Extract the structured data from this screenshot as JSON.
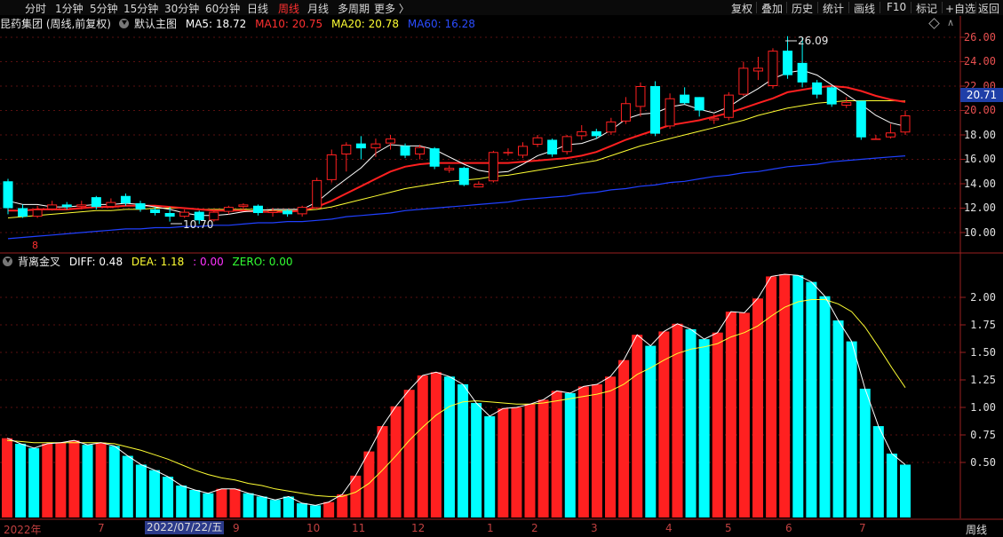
{
  "toolbar": {
    "periods": [
      "分时",
      "1分钟",
      "5分钟",
      "15分钟",
      "30分钟",
      "60分钟",
      "日线",
      "周线",
      "月线",
      "多周期",
      "更多 〉"
    ],
    "active_period": "周线",
    "right_buttons": [
      "复权",
      "叠加",
      "历史",
      "统计",
      "画线",
      "F10",
      "标记",
      "+自选",
      "返回"
    ]
  },
  "main_header": {
    "title": "昆药集团 (周线,前复权)",
    "indicator": "默认主图",
    "ma5": "MA5: 18.72",
    "ma10": "MA10: 20.75",
    "ma20": "MA20: 20.78",
    "ma60": "MA60: 16.28"
  },
  "macd_header": {
    "indicator": "背离金叉",
    "diff": "DIFF: 0.48",
    "dea": "DEA: 1.18",
    "extra": ": 0.00",
    "zero": "ZERO: 0.00"
  },
  "price_axis": [
    "26.00",
    "24.00",
    "22.00",
    "20.00",
    "18.00",
    "16.00",
    "14.00",
    "12.00",
    "10.00"
  ],
  "macd_axis": [
    "2.00",
    "1.75",
    "1.50",
    "1.25",
    "1.00",
    "0.75",
    "0.50"
  ],
  "current_price": "20.71",
  "high_label": "26.09",
  "low_label": "10.70",
  "time_axis": [
    "2022年",
    "7",
    "9",
    "10",
    "11",
    "12",
    "1",
    "2",
    "3",
    "4",
    "5",
    "6",
    "7"
  ],
  "cursor_date": "2022/07/22/五",
  "footer_period": "周线",
  "colors": {
    "up": "#ff2020",
    "down": "#00ffff",
    "ma5": "#ffffff",
    "ma10": "#ff2020",
    "ma20": "#ffff33",
    "ma60": "#2040ff",
    "active": "#ff3030"
  },
  "chart_data": [
    {
      "type": "candlestick",
      "title": "昆药集团 (周线,前复权)",
      "ylim": [
        9,
        27
      ],
      "candles": [
        [
          14.2,
          12.0,
          14.4,
          11.5
        ],
        [
          12.0,
          11.3,
          12.3,
          11.2
        ],
        [
          11.3,
          11.9,
          12.2,
          11.2
        ],
        [
          11.9,
          12.3,
          12.6,
          11.8
        ],
        [
          12.3,
          12.1,
          12.5,
          11.9
        ],
        [
          12.1,
          12.3,
          12.6,
          11.9
        ],
        [
          12.9,
          12.1,
          13.0,
          11.9
        ],
        [
          12.1,
          12.5,
          12.8,
          12.0
        ],
        [
          13.0,
          12.4,
          13.2,
          12.2
        ],
        [
          12.4,
          11.9,
          12.6,
          11.7
        ],
        [
          11.9,
          11.6,
          12.1,
          11.4
        ],
        [
          11.6,
          11.3,
          12.1,
          10.9
        ],
        [
          11.3,
          11.7,
          11.9,
          11.2
        ],
        [
          11.7,
          11.0,
          11.8,
          10.7
        ],
        [
          11.0,
          11.7,
          11.9,
          10.9
        ],
        [
          11.7,
          12.1,
          12.2,
          11.5
        ],
        [
          12.1,
          12.3,
          12.4,
          11.8
        ],
        [
          12.2,
          11.6,
          12.3,
          11.4
        ],
        [
          11.6,
          11.8,
          12.0,
          11.3
        ],
        [
          11.8,
          11.5,
          11.9,
          11.3
        ],
        [
          11.5,
          12.1,
          12.2,
          11.3
        ],
        [
          12.0,
          14.3,
          14.5,
          11.9
        ],
        [
          14.3,
          16.4,
          16.8,
          14.1
        ],
        [
          16.4,
          17.2,
          17.4,
          15.0
        ],
        [
          17.3,
          16.9,
          17.9,
          16.0
        ],
        [
          16.9,
          17.3,
          17.7,
          16.2
        ],
        [
          17.3,
          17.7,
          18.0,
          16.8
        ],
        [
          17.1,
          16.3,
          17.3,
          16.1
        ],
        [
          16.4,
          17.0,
          17.2,
          16.0
        ],
        [
          16.9,
          15.4,
          17.0,
          15.2
        ],
        [
          15.1,
          15.3,
          15.5,
          14.9
        ],
        [
          15.3,
          13.9,
          15.4,
          13.8
        ],
        [
          13.7,
          14.0,
          14.2,
          13.7
        ],
        [
          14.2,
          16.6,
          16.7,
          14.1
        ],
        [
          16.5,
          16.6,
          16.9,
          16.3
        ],
        [
          16.3,
          17.1,
          17.4,
          16.1
        ],
        [
          17.2,
          17.8,
          18.0,
          17.0
        ],
        [
          17.6,
          16.4,
          17.7,
          16.2
        ],
        [
          16.6,
          17.9,
          18.0,
          16.4
        ],
        [
          17.9,
          18.3,
          18.8,
          17.6
        ],
        [
          18.3,
          17.9,
          18.5,
          17.7
        ],
        [
          18.2,
          19.1,
          19.4,
          18.0
        ],
        [
          19.1,
          20.6,
          21.1,
          18.9
        ],
        [
          20.3,
          22.0,
          22.3,
          19.5
        ],
        [
          22.0,
          18.1,
          22.4,
          17.9
        ],
        [
          18.7,
          21.0,
          21.4,
          18.5
        ],
        [
          21.3,
          20.6,
          21.9,
          20.5
        ],
        [
          21.1,
          20.0,
          21.1,
          19.5
        ],
        [
          19.2,
          19.4,
          19.7,
          18.9
        ],
        [
          19.4,
          21.3,
          21.5,
          19.2
        ],
        [
          21.3,
          23.5,
          24.0,
          21.2
        ],
        [
          23.2,
          23.5,
          24.4,
          22.5
        ],
        [
          22.0,
          24.9,
          25.1,
          21.8
        ],
        [
          24.9,
          22.9,
          26.09,
          22.6
        ],
        [
          23.9,
          22.3,
          26.0,
          21.9
        ],
        [
          22.3,
          21.3,
          22.5,
          21.0
        ],
        [
          21.9,
          20.5,
          22.0,
          20.3
        ],
        [
          20.4,
          20.7,
          21.1,
          20.2
        ],
        [
          20.8,
          17.8,
          20.8,
          17.6
        ],
        [
          17.7,
          17.7,
          18.0,
          17.6
        ],
        [
          17.8,
          18.2,
          18.9,
          17.7
        ],
        [
          18.2,
          19.6,
          20.0,
          18.0
        ]
      ],
      "ma5": [
        12.6,
        12.3,
        12.3,
        12.1,
        12.1,
        12.2,
        12.3,
        12.3,
        12.4,
        12.3,
        12.1,
        11.9,
        11.6,
        11.4,
        11.4,
        11.5,
        11.7,
        11.8,
        11.9,
        11.9,
        11.9,
        12.5,
        13.5,
        14.4,
        15.3,
        16.5,
        17.2,
        17.1,
        17.1,
        16.8,
        16.2,
        15.6,
        15.1,
        14.9,
        15.0,
        15.6,
        16.3,
        16.7,
        17.2,
        17.3,
        17.7,
        18.4,
        19.3,
        19.7,
        19.8,
        20.3,
        20.5,
        20.1,
        19.8,
        20.3,
        21.1,
        21.8,
        22.6,
        23.1,
        23.3,
        22.9,
        22.1,
        21.3,
        20.5,
        19.6,
        19.0,
        18.7
      ],
      "ma10": [
        11.8,
        11.8,
        11.9,
        11.9,
        11.9,
        12.0,
        12.1,
        12.1,
        12.2,
        12.2,
        12.2,
        12.1,
        12.0,
        11.9,
        11.8,
        11.8,
        11.8,
        11.7,
        11.7,
        11.7,
        11.8,
        12.1,
        12.6,
        13.2,
        13.8,
        14.4,
        15.0,
        15.4,
        15.6,
        15.7,
        15.7,
        15.7,
        15.7,
        15.7,
        15.7,
        15.8,
        15.9,
        16.0,
        16.1,
        16.3,
        16.6,
        17.1,
        17.6,
        18.0,
        18.4,
        18.8,
        19.0,
        19.2,
        19.5,
        19.8,
        20.2,
        20.6,
        21.0,
        21.5,
        21.7,
        21.9,
        22.0,
        21.9,
        21.6,
        21.2,
        20.9,
        20.7
      ],
      "ma20": [
        11.2,
        11.3,
        11.4,
        11.5,
        11.6,
        11.7,
        11.8,
        11.8,
        11.9,
        11.9,
        12.0,
        12.0,
        12.0,
        11.9,
        11.9,
        11.9,
        11.9,
        11.9,
        11.8,
        11.8,
        11.8,
        11.9,
        12.1,
        12.4,
        12.7,
        13.0,
        13.3,
        13.6,
        13.8,
        14.0,
        14.2,
        14.3,
        14.4,
        14.6,
        14.7,
        14.9,
        15.1,
        15.3,
        15.5,
        15.7,
        15.9,
        16.3,
        16.7,
        17.1,
        17.4,
        17.7,
        18.0,
        18.3,
        18.6,
        18.9,
        19.2,
        19.6,
        19.9,
        20.2,
        20.4,
        20.6,
        20.7,
        20.8,
        20.8,
        20.8,
        20.8,
        20.78
      ],
      "ma60": [
        9.5,
        9.6,
        9.7,
        9.8,
        9.9,
        10.0,
        10.1,
        10.2,
        10.3,
        10.3,
        10.4,
        10.4,
        10.5,
        10.5,
        10.6,
        10.6,
        10.7,
        10.8,
        10.8,
        10.9,
        10.9,
        11.0,
        11.1,
        11.3,
        11.4,
        11.5,
        11.6,
        11.8,
        11.9,
        12.0,
        12.1,
        12.2,
        12.3,
        12.4,
        12.5,
        12.7,
        12.8,
        12.9,
        13.0,
        13.2,
        13.3,
        13.5,
        13.6,
        13.8,
        13.9,
        14.1,
        14.2,
        14.4,
        14.6,
        14.7,
        14.9,
        15.0,
        15.2,
        15.4,
        15.5,
        15.6,
        15.8,
        15.9,
        16.0,
        16.1,
        16.2,
        16.28
      ]
    },
    {
      "type": "bar",
      "title": "背离金叉",
      "ylim": [
        0.0,
        2.3
      ],
      "values": [
        0.72,
        0.67,
        0.63,
        0.67,
        0.68,
        0.7,
        0.66,
        0.68,
        0.65,
        0.56,
        0.48,
        0.43,
        0.37,
        0.29,
        0.25,
        0.22,
        0.26,
        0.26,
        0.22,
        0.19,
        0.16,
        0.19,
        0.13,
        0.11,
        0.14,
        0.21,
        0.38,
        0.6,
        0.83,
        1.01,
        1.16,
        1.29,
        1.32,
        1.28,
        1.21,
        1.04,
        0.92,
        0.99,
        1.0,
        1.03,
        1.07,
        1.15,
        1.13,
        1.19,
        1.21,
        1.28,
        1.43,
        1.66,
        1.56,
        1.69,
        1.76,
        1.71,
        1.62,
        1.68,
        1.87,
        1.86,
        1.99,
        2.19,
        2.21,
        2.2,
        2.14,
        2.01,
        1.79,
        1.6,
        1.17,
        0.83,
        0.58,
        0.48
      ],
      "colors": [
        "u",
        "d",
        "d",
        "u",
        "u",
        "u",
        "d",
        "u",
        "d",
        "d",
        "d",
        "d",
        "d",
        "d",
        "d",
        "d",
        "u",
        "u",
        "d",
        "d",
        "d",
        "d",
        "d",
        "d",
        "u",
        "u",
        "u",
        "u",
        "u",
        "u",
        "u",
        "u",
        "u",
        "d",
        "d",
        "d",
        "d",
        "u",
        "u",
        "u",
        "u",
        "u",
        "d",
        "u",
        "u",
        "u",
        "u",
        "u",
        "d",
        "u",
        "u",
        "d",
        "d",
        "u",
        "u",
        "u",
        "u",
        "u",
        "u",
        "d",
        "d",
        "d",
        "d",
        "d",
        "d",
        "d",
        "d",
        "d"
      ],
      "dea": [
        0.7,
        0.69,
        0.68,
        0.68,
        0.68,
        0.68,
        0.68,
        0.68,
        0.67,
        0.64,
        0.61,
        0.57,
        0.53,
        0.48,
        0.43,
        0.39,
        0.36,
        0.34,
        0.31,
        0.29,
        0.26,
        0.24,
        0.22,
        0.2,
        0.19,
        0.19,
        0.23,
        0.31,
        0.43,
        0.56,
        0.7,
        0.82,
        0.93,
        1.01,
        1.05,
        1.06,
        1.05,
        1.04,
        1.03,
        1.03,
        1.04,
        1.06,
        1.08,
        1.1,
        1.12,
        1.15,
        1.21,
        1.3,
        1.36,
        1.43,
        1.49,
        1.53,
        1.55,
        1.58,
        1.64,
        1.68,
        1.74,
        1.83,
        1.91,
        1.96,
        1.98,
        1.98,
        1.94,
        1.87,
        1.73,
        1.55,
        1.36,
        1.18
      ]
    }
  ]
}
